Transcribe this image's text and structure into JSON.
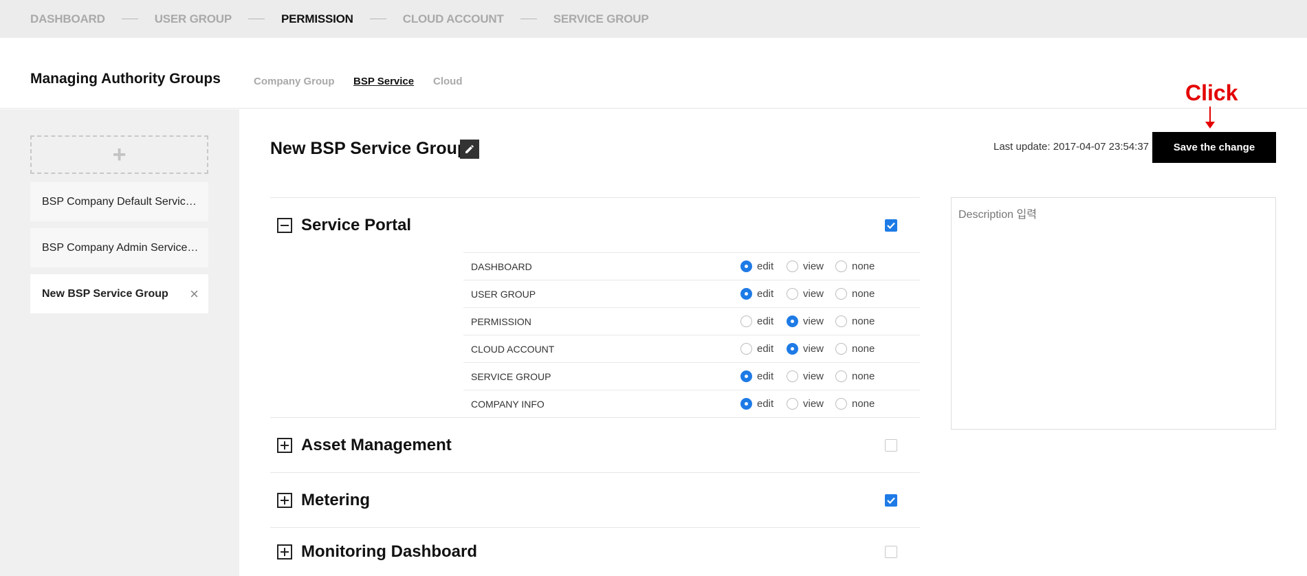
{
  "nav": {
    "steps": [
      "DASHBOARD",
      "USER GROUP",
      "PERMISSION",
      "CLOUD ACCOUNT",
      "SERVICE GROUP"
    ],
    "active_step": "PERMISSION"
  },
  "header": {
    "title": "Managing Authority Groups",
    "subtabs": [
      "Company Group",
      "BSP Service",
      "Cloud"
    ],
    "active_subtab": "BSP Service"
  },
  "sidebar": {
    "add_label": "+",
    "groups": [
      {
        "label": "BSP Company Default Service Group"
      },
      {
        "label": "BSP Company Admin Service Group"
      },
      {
        "label": "New BSP Service Group",
        "active": true
      }
    ],
    "close_glyph": "×"
  },
  "main": {
    "title": "New BSP Service Group",
    "last_update": "Last update: 2017-04-07 23:54:37",
    "save_label": "Save the change",
    "annotation": "Click",
    "description_placeholder": "Description 입력"
  },
  "sections": [
    {
      "title": "Service Portal",
      "expanded": true,
      "checked": true,
      "permissions": [
        {
          "name": "DASHBOARD",
          "value": "edit"
        },
        {
          "name": "USER GROUP",
          "value": "edit"
        },
        {
          "name": "PERMISSION",
          "value": "view"
        },
        {
          "name": "CLOUD ACCOUNT",
          "value": "view"
        },
        {
          "name": "SERVICE GROUP",
          "value": "edit"
        },
        {
          "name": "COMPANY INFO",
          "value": "edit"
        }
      ]
    },
    {
      "title": "Asset Management",
      "expanded": false,
      "checked": false
    },
    {
      "title": "Metering",
      "expanded": false,
      "checked": true
    },
    {
      "title": "Monitoring Dashboard",
      "expanded": false,
      "checked": false
    }
  ],
  "radio_options": [
    "edit",
    "view",
    "none"
  ],
  "colors": {
    "accent": "#1e7be6",
    "annotation": "#e30000",
    "save_bg": "#000000"
  }
}
